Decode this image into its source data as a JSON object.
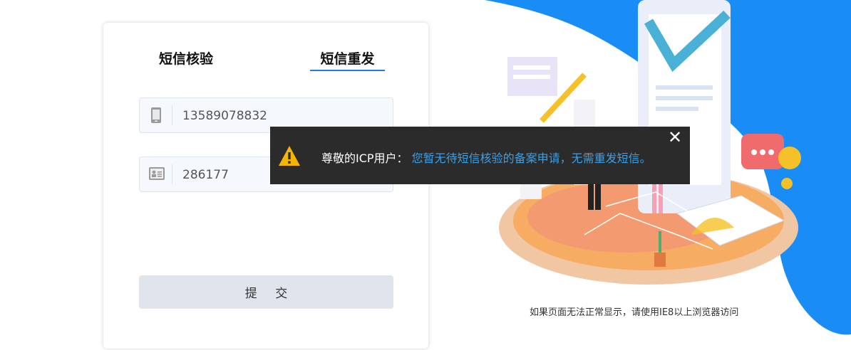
{
  "tabs": {
    "verify_label": "短信核验",
    "resend_label": "短信重发",
    "active": "resend"
  },
  "form": {
    "phone_value": "13589078832",
    "code_value": "286177",
    "submit_label": "提 交"
  },
  "browser_hint": "如果页面无法正常显示，请使用IE8以上浏览器访问",
  "toast": {
    "lead": "尊敬的ICP用户：",
    "message": "您暂无待短信核验的备案申请，无需重发短信。",
    "close_glyph": "✕",
    "icon": "warning-icon"
  },
  "colors": {
    "accent": "#1e7be6",
    "toast_bg": "#2b2b2b",
    "toast_highlight": "#3aa0e8",
    "hero_blue": "#1a8cf6"
  }
}
